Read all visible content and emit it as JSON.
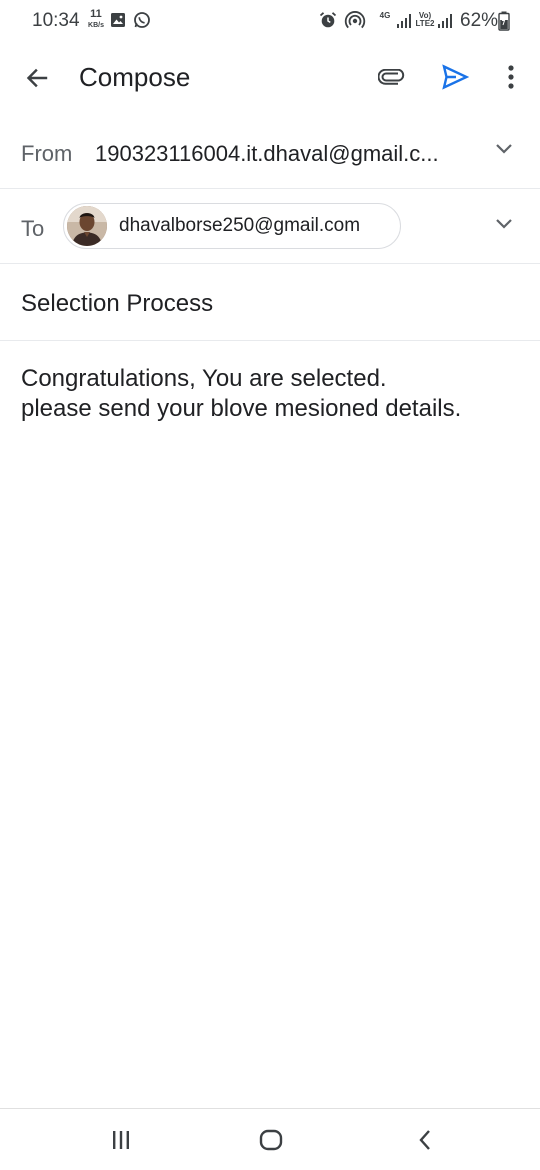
{
  "status_bar": {
    "time": "10:34",
    "speed_value": "11",
    "speed_unit": "KB/s",
    "network1_label": "4G",
    "network2_label": "Vo) LTE2",
    "battery": "62%",
    "icons": [
      "gallery-icon",
      "whatsapp-icon",
      "alarm-icon",
      "hotspot-icon",
      "signal-icon",
      "battery-icon"
    ]
  },
  "app_bar": {
    "title": "Compose",
    "icons": [
      "back-arrow-icon",
      "paperclip-icon",
      "send-icon",
      "more-vert-icon"
    ],
    "accent_color": "#1a73e8"
  },
  "from": {
    "label": "From",
    "value": "190323116004.it.dhaval@gmail.c..."
  },
  "to": {
    "label": "To",
    "recipient": "dhavalborse250@gmail.com"
  },
  "subject": "Selection Process",
  "body": {
    "line1": "Congratulations, You are selected.",
    "line2": "please send your blove mesioned details."
  },
  "nav_bar": {
    "icons": [
      "recents-icon",
      "home-icon",
      "nav-back-icon"
    ]
  }
}
